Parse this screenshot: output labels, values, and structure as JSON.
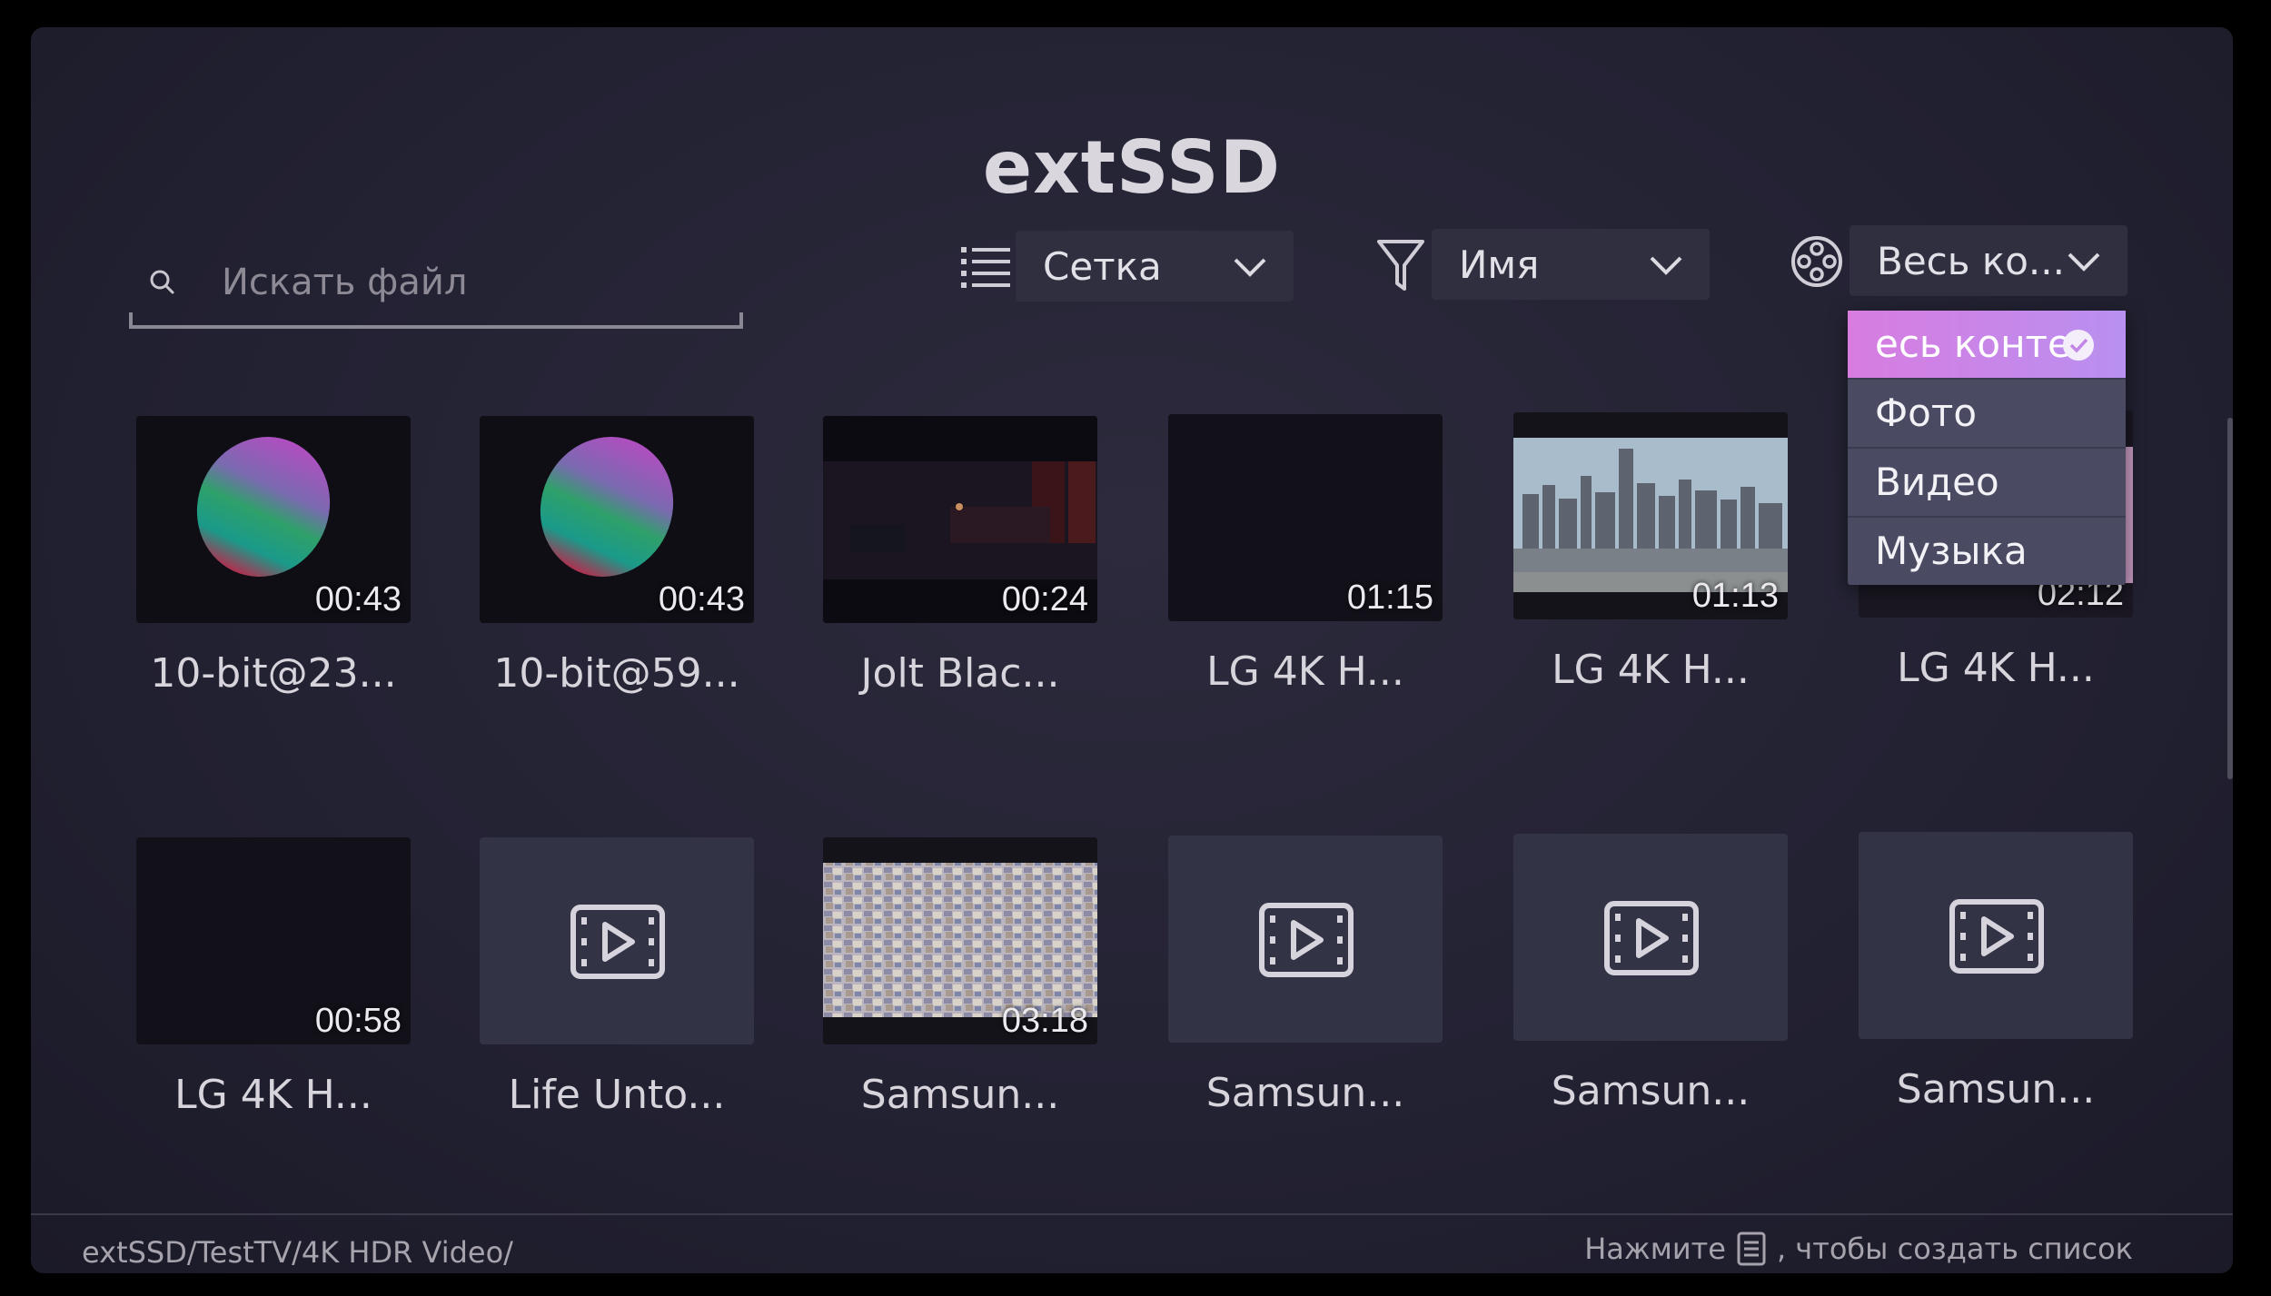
{
  "header": {
    "title": "extSSD"
  },
  "search": {
    "placeholder": "Искать файл",
    "icon": "search-icon"
  },
  "toolbar": {
    "view": {
      "icon": "list-icon",
      "label": "Сетка"
    },
    "sort": {
      "icon": "filter-icon",
      "label": "Имя"
    },
    "content": {
      "icon": "film-reel-icon",
      "label": "Весь ко..."
    }
  },
  "content_menu": {
    "items": [
      {
        "label": "есь конте",
        "selected": true
      },
      {
        "label": "Фото",
        "selected": false
      },
      {
        "label": "Видео",
        "selected": false
      },
      {
        "label": "Музыка",
        "selected": false
      }
    ]
  },
  "grid": {
    "tiles": [
      {
        "title": "10-bit@23...",
        "duration": "00:43",
        "thumb": "gradient-sphere"
      },
      {
        "title": "10-bit@59...",
        "duration": "00:43",
        "thumb": "gradient-sphere"
      },
      {
        "title": "Jolt Blac...",
        "duration": "00:24",
        "thumb": "dark-room"
      },
      {
        "title": "LG 4K H...",
        "duration": "01:15",
        "thumb": "black"
      },
      {
        "title": "LG 4K H...",
        "duration": "01:13",
        "thumb": "city-skyline"
      },
      {
        "title": "LG 4K H...",
        "duration": "02:12",
        "thumb": "pink"
      },
      {
        "title": "LG 4K H...",
        "duration": "00:58",
        "thumb": "black"
      },
      {
        "title": "Life Unto...",
        "duration": "",
        "thumb": "placeholder"
      },
      {
        "title": "Samsun...",
        "duration": "03:18",
        "thumb": "town-aerial"
      },
      {
        "title": "Samsun...",
        "duration": "",
        "thumb": "placeholder"
      },
      {
        "title": "Samsun...",
        "duration": "",
        "thumb": "placeholder"
      },
      {
        "title": "Samsun...",
        "duration": "",
        "thumb": "placeholder"
      }
    ]
  },
  "footer": {
    "path": "extSSD/TestTV/4K HDR Video/",
    "hint_before": "Нажмите",
    "hint_after": ", чтобы создать список"
  },
  "colors": {
    "accent": "#d87ce0",
    "background": "#232233",
    "menu": "#4a4b62"
  }
}
